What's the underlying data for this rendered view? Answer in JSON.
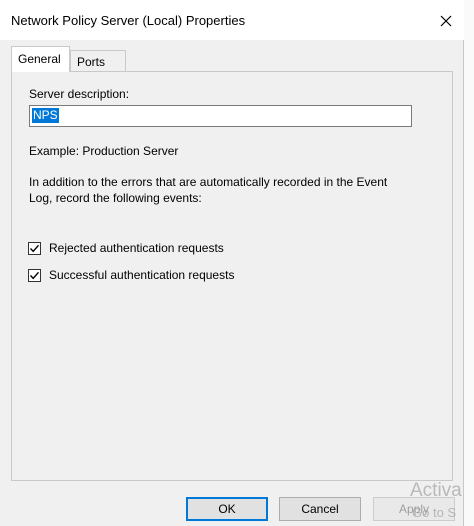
{
  "window": {
    "title": "Network Policy Server (Local) Properties"
  },
  "tabs": [
    {
      "label": "General",
      "active": true
    },
    {
      "label": "Ports",
      "active": false
    }
  ],
  "general": {
    "server_description_label": "Server description:",
    "server_description_value": "NPS",
    "example_text": "Example: Production Server",
    "info_line1": "In addition to the errors that are automatically recorded in the Event",
    "info_line2": "Log, record the following events:",
    "checkboxes": [
      {
        "label": "Rejected authentication requests",
        "checked": true
      },
      {
        "label": "Successful authentication requests",
        "checked": true
      }
    ]
  },
  "buttons": {
    "ok": "OK",
    "cancel": "Cancel",
    "apply": "Apply"
  },
  "watermark": {
    "line1": "Activa",
    "line2": "Go to S"
  },
  "colors": {
    "accent": "#0078d7",
    "window_bg": "#f0f0f0"
  }
}
